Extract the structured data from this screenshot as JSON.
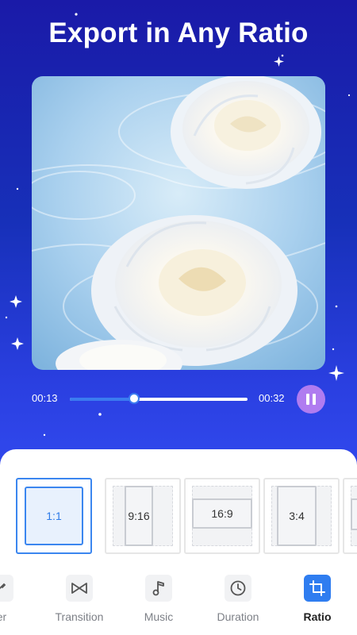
{
  "headline": "Export in Any Ratio",
  "player": {
    "current_time": "00:13",
    "total_time": "00:32",
    "progress": 0.36,
    "pause_icon": "pause-icon"
  },
  "ratios": [
    {
      "label": "1:1",
      "selected": true
    },
    {
      "label": "9:16",
      "selected": false
    },
    {
      "label": "16:9",
      "selected": false
    },
    {
      "label": "3:4",
      "selected": false
    },
    {
      "label": "",
      "selected": false
    }
  ],
  "tabs": [
    {
      "label": "ter",
      "icon": "filter-icon",
      "active": false
    },
    {
      "label": "Transition",
      "icon": "transition-icon",
      "active": false
    },
    {
      "label": "Music",
      "icon": "music-note-icon",
      "active": false
    },
    {
      "label": "Duration",
      "icon": "clock-icon",
      "active": false
    },
    {
      "label": "Ratio",
      "icon": "crop-icon",
      "active": true
    }
  ],
  "colors": {
    "accent": "#2f7df0",
    "pause_button": "#b07cf0",
    "background_top": "#1a1aa8",
    "background_bottom": "#2f46ea"
  }
}
